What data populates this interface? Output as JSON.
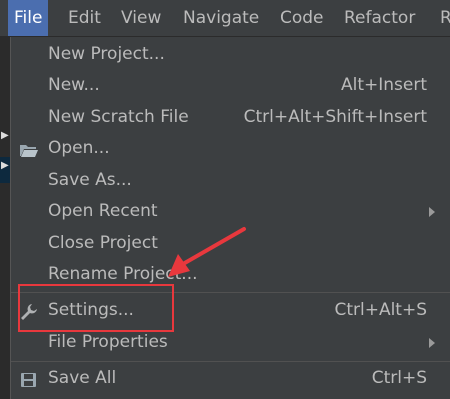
{
  "menubar": {
    "items": [
      {
        "label": "File",
        "active": true
      },
      {
        "label": "Edit"
      },
      {
        "label": "View"
      },
      {
        "label": "Navigate"
      },
      {
        "label": "Code"
      },
      {
        "label": "Refactor"
      },
      {
        "label": "R"
      }
    ]
  },
  "file_menu": {
    "items": [
      {
        "label": "New Project...",
        "shortcut": ""
      },
      {
        "label": "New...",
        "shortcut": "Alt+Insert"
      },
      {
        "label": "New Scratch File",
        "shortcut": "Ctrl+Alt+Shift+Insert"
      },
      {
        "label": "Open...",
        "shortcut": "",
        "icon": "folder-open-icon"
      },
      {
        "label": "Save As...",
        "shortcut": ""
      },
      {
        "label": "Open Recent",
        "submenu": true
      },
      {
        "label": "Close Project",
        "shortcut": ""
      },
      {
        "label": "Rename Project...",
        "shortcut": ""
      },
      {
        "label": "Settings...",
        "shortcut": "Ctrl+Alt+S",
        "icon": "wrench-icon",
        "annotated": true
      },
      {
        "label": "File Properties",
        "submenu": true
      },
      {
        "label": "Save All",
        "shortcut": "Ctrl+S",
        "icon": "save-all-icon"
      }
    ]
  },
  "annotation": {
    "color": "#e8383d",
    "target": "Settings..."
  },
  "colors": {
    "menubar_active": "#4b6eaf",
    "menu_bg": "#3c3f41",
    "text": "#bbbbbb"
  }
}
